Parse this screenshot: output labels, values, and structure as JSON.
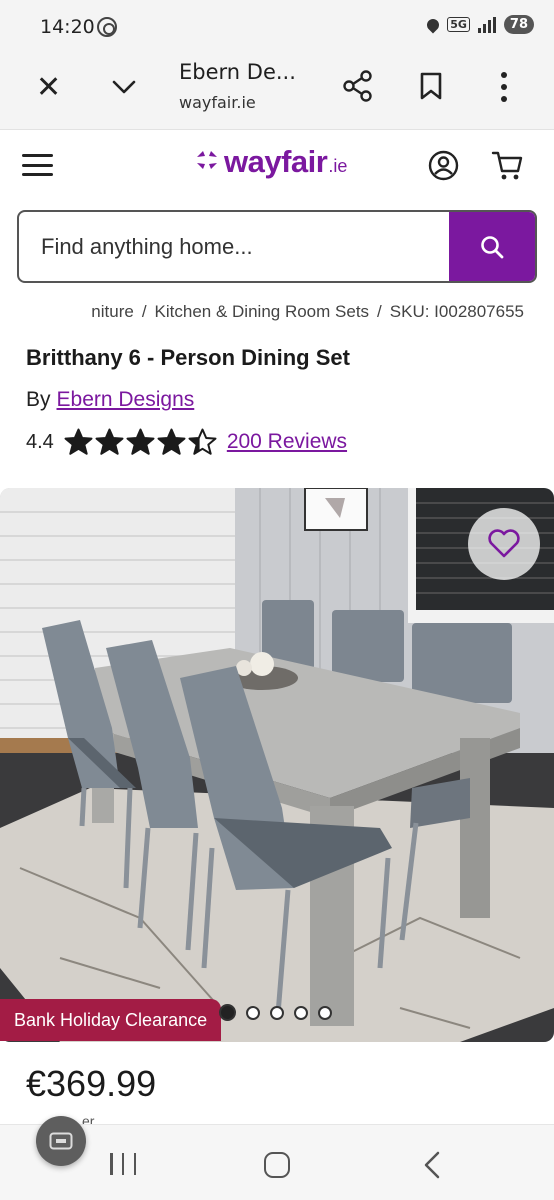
{
  "status_bar": {
    "time": "14:20",
    "network": "5G",
    "battery": "78"
  },
  "browser": {
    "title": "Ebern De...",
    "url": "wayfair.ie"
  },
  "header": {
    "logo_word": "wayfair",
    "logo_tld": ".ie"
  },
  "search": {
    "placeholder": "Find anything home..."
  },
  "breadcrumb": {
    "items": [
      "niture",
      "Kitchen & Dining Room Sets",
      "SKU: I002807655"
    ],
    "separator": "/"
  },
  "product": {
    "title": "Britthany 6 - Person Dining Set",
    "by_label": "By",
    "brand": "Ebern Designs",
    "rating": "4.4",
    "rating_fraction": 0.88,
    "reviews": "200 Reviews",
    "promo_badge": "Bank Holiday Clearance",
    "price": "€369.99",
    "price_note_peek": "er",
    "carousel_count": 5,
    "carousel_active": 1
  },
  "colors": {
    "brand": "#7b189f",
    "promo": "#a31c45"
  },
  "icons": [
    "close-icon",
    "chevron-down-icon",
    "share-icon",
    "bookmark-icon",
    "more-icon",
    "menu-icon",
    "account-icon",
    "cart-icon",
    "search-icon",
    "star-icon",
    "heart-icon"
  ]
}
